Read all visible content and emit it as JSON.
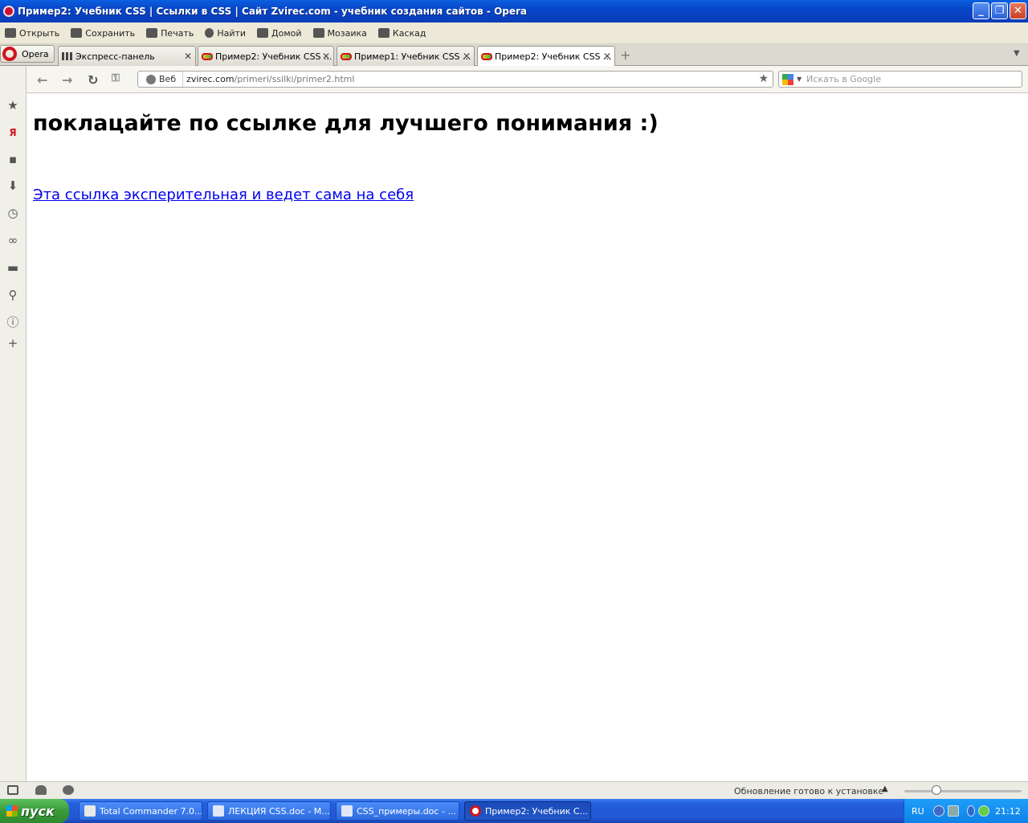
{
  "window": {
    "title": "Пример2: Учебник CSS | Ссылки в CSS | Сайт Zvirec.com - учебник создания сайтов - Opera"
  },
  "menu": [
    "Открыть",
    "Сохранить",
    "Печать",
    "Найти",
    "Домой",
    "Мозаика",
    "Каскад"
  ],
  "opera_button": "Opera",
  "tabs": [
    {
      "label": "Экспресс-панель",
      "active": false
    },
    {
      "label": "Пример2: Учебник CSS ...",
      "active": false
    },
    {
      "label": "Пример1: Учебник CSS ...",
      "active": false
    },
    {
      "label": "Пример2: Учебник CSS ...",
      "active": true
    }
  ],
  "address": {
    "zone_label": "Веб",
    "url_host": "zvirec.com",
    "url_path": "/primeri/ssilki/primer2.html"
  },
  "search": {
    "placeholder": "Искать в Google"
  },
  "page": {
    "heading": "поклацайте по ссылке для лучшего понимания :)",
    "link": "Эта ссылка эксперительная и ведет сама на себя"
  },
  "status": {
    "update_text": "Обновление готово к установке"
  },
  "taskbar": {
    "start": "пуск",
    "tasks": [
      "Total Commander 7.0...",
      "ЛЕКЦИЯ CSS.doc - M...",
      "CSS_примеры.doc - ...",
      "Пример2: Учебник С..."
    ],
    "lang": "RU",
    "clock": "21:12"
  },
  "colors": {
    "link": "#0000ee",
    "titlebar": "#0a4fd8",
    "taskbar": "#245edb",
    "start": "#3a9a3a"
  }
}
